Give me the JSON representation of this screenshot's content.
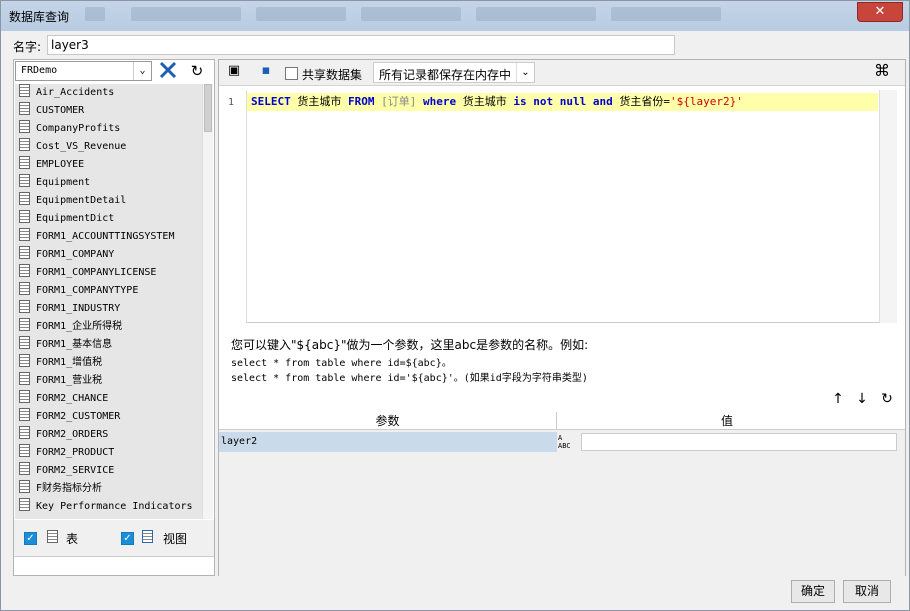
{
  "window": {
    "title": "数据库查询",
    "close_label": "✕"
  },
  "name_row": {
    "label": "名字:",
    "value": "layer3"
  },
  "datasource": {
    "selected": "FRDemo"
  },
  "tables": [
    "Air_Accidents",
    "CUSTOMER",
    "CompanyProfits",
    "Cost_VS_Revenue",
    "EMPLOYEE",
    "Equipment",
    "EquipmentDetail",
    "EquipmentDict",
    "FORM1_ACCOUNTTINGSYSTEM",
    "FORM1_COMPANY",
    "FORM1_COMPANYLICENSE",
    "FORM1_COMPANYTYPE",
    "FORM1_INDUSTRY",
    "FORM1_企业所得税",
    "FORM1_基本信息",
    "FORM1_增值税",
    "FORM1_营业税",
    "FORM2_CHANCE",
    "FORM2_CUSTOMER",
    "FORM2_ORDERS",
    "FORM2_PRODUCT",
    "FORM2_SERVICE",
    "F财务指标分析",
    "Key Performance Indicators"
  ],
  "filters": {
    "table_label": "表",
    "view_label": "视图"
  },
  "toolbar": {
    "share_label": "共享数据集",
    "memory_option": "所有记录都保存在内存中"
  },
  "sql": {
    "line_number": "1",
    "kw_select": "SELECT",
    "col1": " 货主城市 ",
    "kw_from": "FROM",
    "table": " [订单] ",
    "kw_where": "where",
    "col2": " 货主城市 ",
    "kw_is": "is not null",
    "kw_and": " and ",
    "col3": "货主省份=",
    "param": "'${layer2}'"
  },
  "hint": {
    "line1": "您可以键入\"${abc}\"做为一个参数，这里abc是参数的名称。例如:",
    "line2": "select * from table where id=${abc}。",
    "line3": "select * from table where id='${abc}'。(如果id字段为字符串类型)"
  },
  "params_table": {
    "col_param": "参数",
    "col_value": "值",
    "rows": [
      {
        "name": "layer2",
        "value": ""
      }
    ],
    "type_badge": "A̲\nABC"
  },
  "buttons": {
    "ok": "确定",
    "cancel": "取消"
  }
}
